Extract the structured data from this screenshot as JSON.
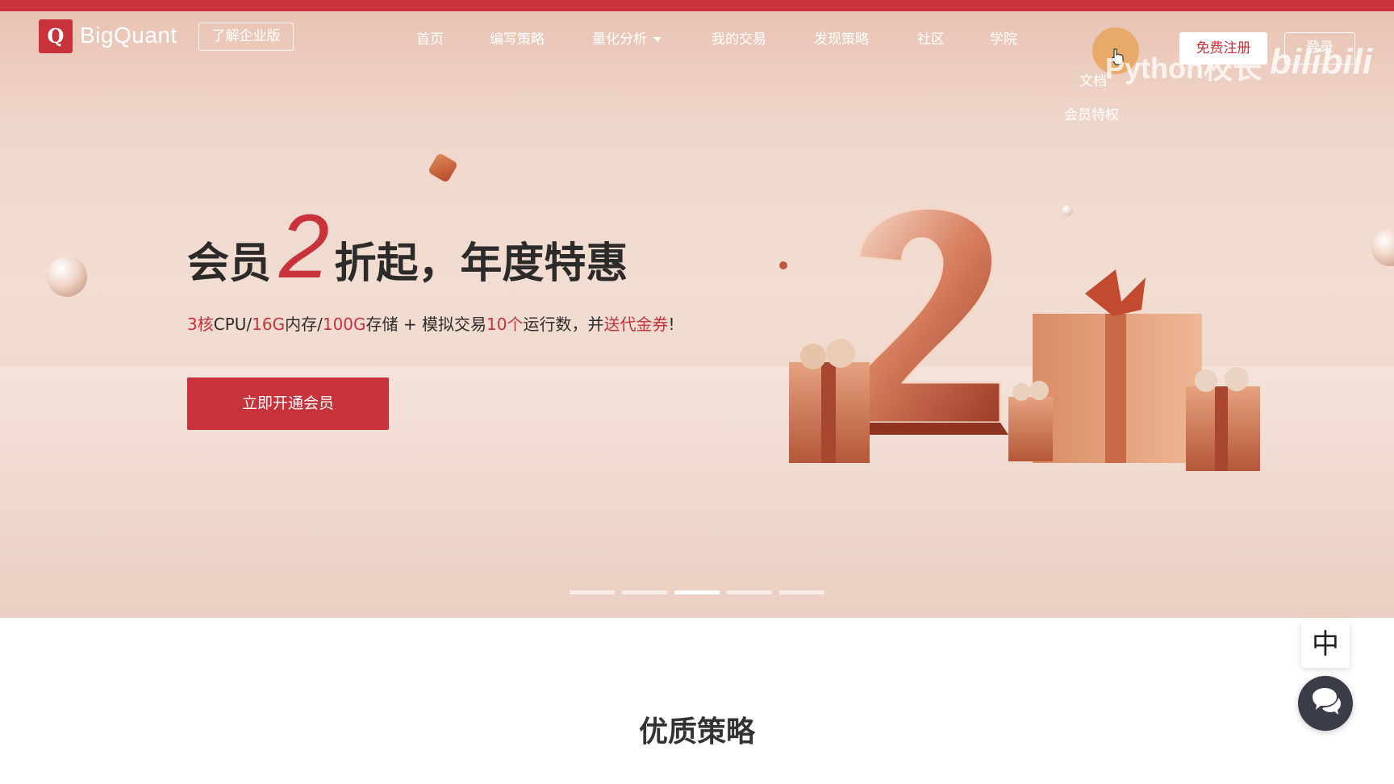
{
  "header": {
    "logo_letter": "Q",
    "logo_text": "BigQuant",
    "enterprise_label": "了解企业版",
    "nav": [
      "首页",
      "编写策略",
      "量化分析",
      "我的交易",
      "发现策略",
      "社区",
      "学院"
    ],
    "dropdown": [
      "文档",
      "会员特权"
    ],
    "register_label": "免费注册",
    "login_label": "登录"
  },
  "watermark": {
    "channel": "Python校长",
    "site": "bilibili"
  },
  "hero": {
    "headline_pre": "会员",
    "headline_num": "2",
    "headline_post": "折起，年度特惠",
    "sub": {
      "p1": "3核",
      "p2": "CPU/",
      "p3": "16G",
      "p4": "内存/",
      "p5": "100G",
      "p6": "存储 + 模拟交易",
      "p7": "10个",
      "p8": "运行数，并",
      "p9": "送代金券",
      "p10": "!"
    },
    "cta_label": "立即开通会员",
    "carousel": {
      "count": 5,
      "active_index": 2
    }
  },
  "section": {
    "title": "优质策略"
  },
  "side": {
    "lang_label": "中"
  },
  "colors": {
    "brand": "#c8323a",
    "hero_bg": "#efd6ca",
    "text": "#2d2a2a"
  }
}
